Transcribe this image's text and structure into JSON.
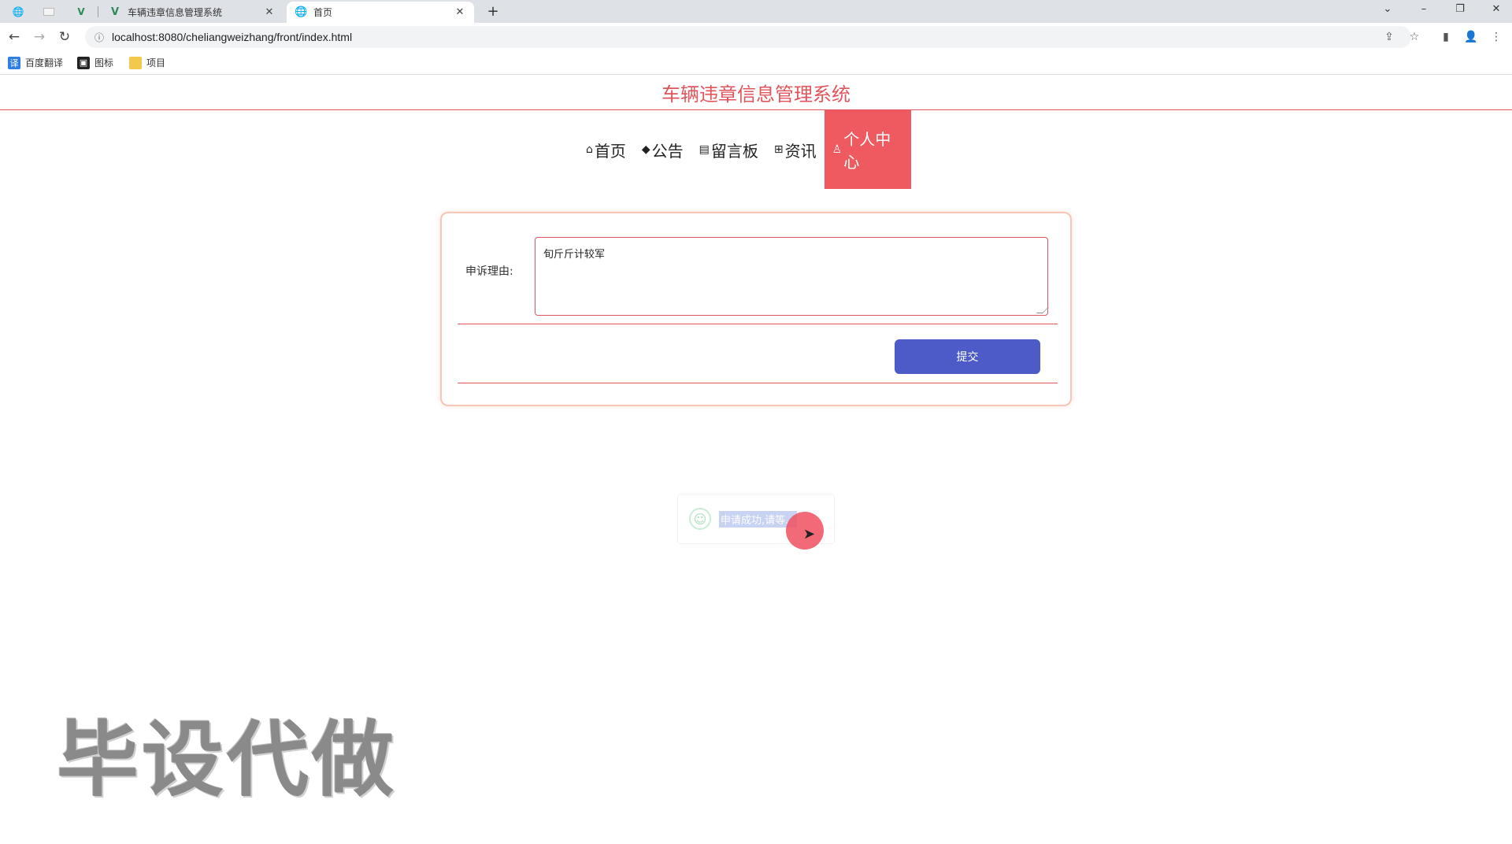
{
  "browser": {
    "tabs": [
      {
        "title": "车辆违章信息管理系统",
        "active": false
      },
      {
        "title": "首页",
        "active": true
      }
    ],
    "url": "localhost:8080/cheliangweizhang/front/index.html",
    "bookmarks": [
      {
        "label": "百度翻译",
        "icon": "translate-icon"
      },
      {
        "label": "图标",
        "icon": "image-icon"
      },
      {
        "label": "项目",
        "icon": "folder-icon"
      }
    ]
  },
  "site": {
    "title": "车辆违章信息管理系统",
    "nav": [
      {
        "label": "首页",
        "icon": "home-icon"
      },
      {
        "label": "公告",
        "icon": "layers-icon"
      },
      {
        "label": "留言板",
        "icon": "note-icon"
      },
      {
        "label": "资讯",
        "icon": "grid-icon"
      },
      {
        "label": "个人中心",
        "icon": "user-icon",
        "active": true
      }
    ]
  },
  "form": {
    "reason_label": "申诉理由:",
    "reason_value": "旬斤斤计较军",
    "submit_label": "提交"
  },
  "toast": {
    "message": "申请成功,请等..."
  },
  "watermark": "毕设代做"
}
